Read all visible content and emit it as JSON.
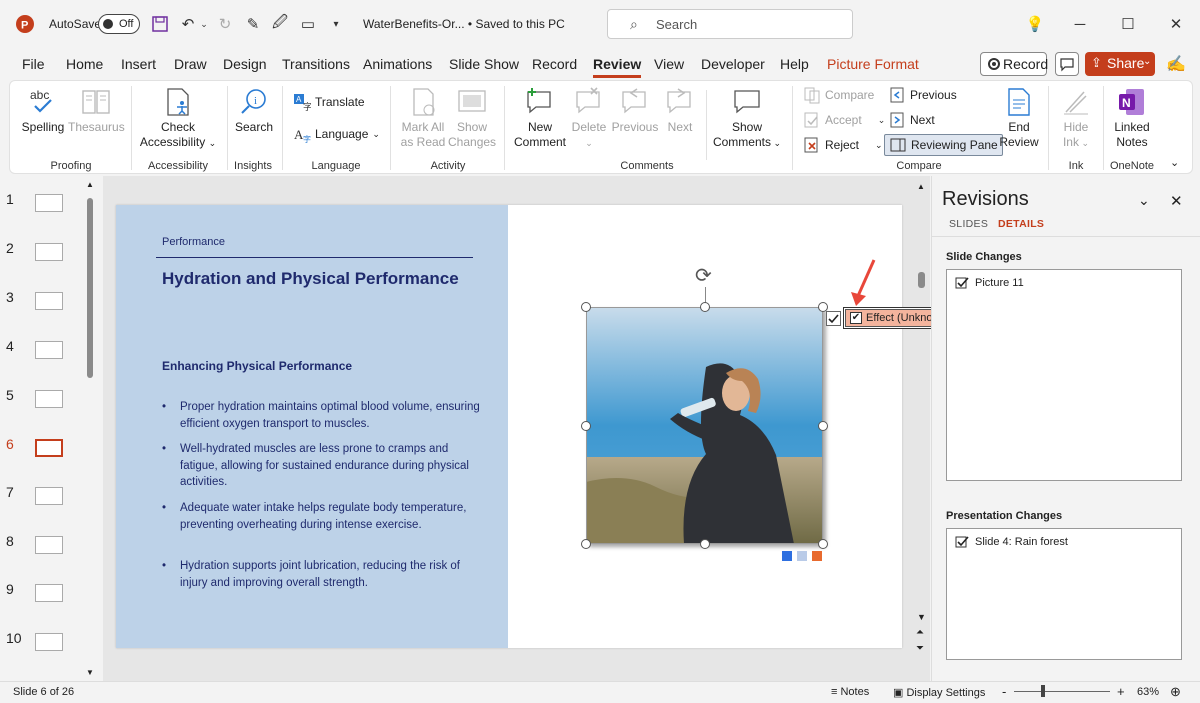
{
  "titlebar": {
    "autosave_label": "AutoSave",
    "autosave_state": "Off",
    "doc_title": "WaterBenefits-Or... • Saved to this PC",
    "search_placeholder": "Search"
  },
  "menu": {
    "tabs": [
      "File",
      "Home",
      "Insert",
      "Draw",
      "Design",
      "Transitions",
      "Animations",
      "Slide Show",
      "Record",
      "Review",
      "View",
      "Developer",
      "Help",
      "Picture Format"
    ],
    "active_tab": "Review",
    "record_label": "Record",
    "share_label": "Share"
  },
  "ribbon": {
    "proofing": {
      "label": "Proofing",
      "spelling": "Spelling",
      "thesaurus": "Thesaurus"
    },
    "accessibility": {
      "label": "Accessibility",
      "check": "Check",
      "check2": "Accessibility"
    },
    "insights": {
      "label": "Insights",
      "search": "Search"
    },
    "language": {
      "label": "Language",
      "translate": "Translate",
      "language": "Language"
    },
    "activity": {
      "label": "Activity",
      "mark_all": "Mark All",
      "as_read": "as Read",
      "show": "Show",
      "changes": "Changes"
    },
    "comments": {
      "label": "Comments",
      "new": "New",
      "comment": "Comment",
      "delete": "Delete",
      "previous": "Previous",
      "next": "Next",
      "show": "Show",
      "comments": "Comments"
    },
    "compare": {
      "label": "Compare",
      "compare": "Compare",
      "accept": "Accept",
      "reject": "Reject",
      "previous": "Previous",
      "next": "Next",
      "reviewing_pane": "Reviewing Pane",
      "end": "End",
      "review": "Review"
    },
    "ink": {
      "label": "Ink",
      "hide": "Hide",
      "ink": "Ink"
    },
    "onenote": {
      "label": "OneNote",
      "linked": "Linked",
      "notes": "Notes"
    }
  },
  "thumbnails": [
    "1",
    "2",
    "3",
    "4",
    "5",
    "6",
    "7",
    "8",
    "9",
    "10"
  ],
  "selected_slide": "6",
  "slide": {
    "section": "Performance",
    "title": "Hydration and Physical Performance",
    "subtitle": "Enhancing Physical Performance",
    "bullets": [
      "Proper hydration maintains optimal blood volume, ensuring efficient oxygen transport to muscles.",
      "Well-hydrated muscles are less prone to cramps and fatigue, allowing for sustained endurance during physical activities.",
      "Adequate water intake helps regulate body temperature, preventing overheating during intense exercise.",
      "Hydration supports joint lubrication, reducing the risk of injury and improving overall strength."
    ],
    "markup_label": "Effect (Unknown User)"
  },
  "revisions": {
    "title": "Revisions",
    "tab_slides": "SLIDES",
    "tab_details": "DETAILS",
    "slide_changes_header": "Slide Changes",
    "slide_changes": [
      "Picture 11"
    ],
    "presentation_changes_header": "Presentation Changes",
    "presentation_changes": [
      "Slide 4: Rain forest"
    ]
  },
  "status": {
    "slide_info": "Slide 6 of 26",
    "notes": "Notes",
    "display_settings": "Display Settings",
    "zoom_minus": "-",
    "zoom_plus": "+",
    "zoom": "63%"
  },
  "colors": {
    "accent": "#c43e1c",
    "slide_left_bg": "#bdd2e8",
    "slide_text": "#1f2a6d",
    "markup_bg": "#f4b49d"
  }
}
